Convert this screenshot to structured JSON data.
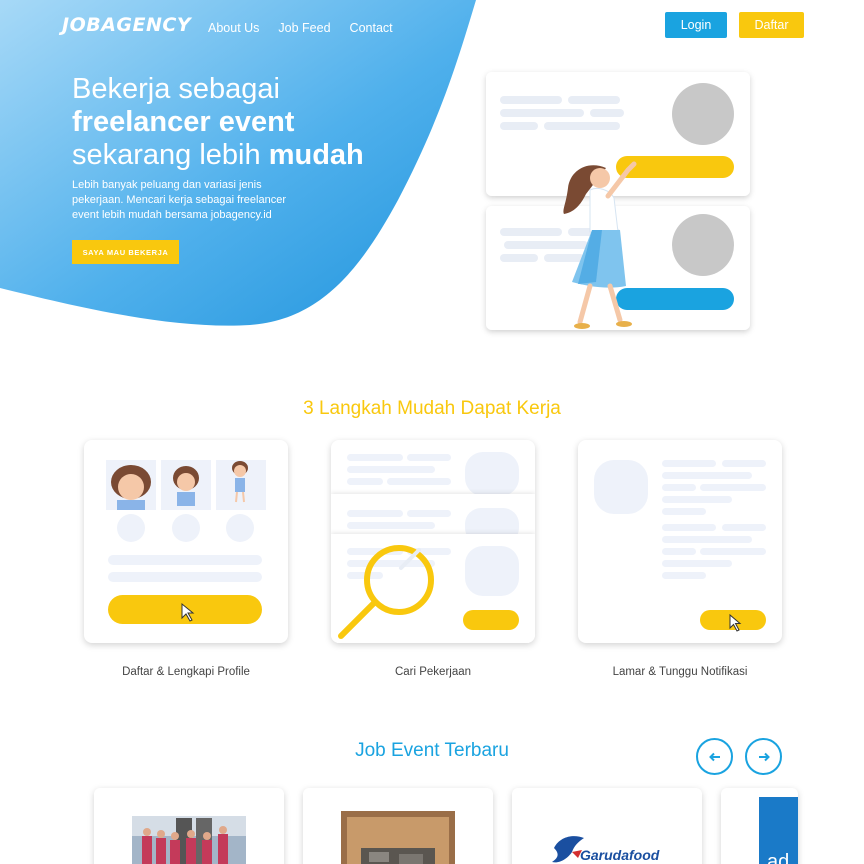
{
  "header": {
    "logo": "JOBAGENCY",
    "nav": [
      "About Us",
      "Job Feed",
      "Contact"
    ],
    "login_label": "Login",
    "daftar_label": "Daftar"
  },
  "hero": {
    "line1": "Bekerja sebagai",
    "line2": "freelancer event",
    "line3_normal": "sekarang lebih ",
    "line3_bold": "mudah",
    "description": "Lebih banyak peluang dan variasi jenis pekerjaan. Mencari kerja sebagai freelancer event lebih mudah bersama jobagency.id",
    "cta_label": "SAYA MAU BEKERJA"
  },
  "steps": {
    "title": "3 Langkah Mudah Dapat Kerja",
    "items": [
      {
        "label": "Daftar & Lengkapi Profile"
      },
      {
        "label": "Cari Pekerjaan"
      },
      {
        "label": "Lamar & Tunggu Notifikasi"
      }
    ]
  },
  "jobs": {
    "title": "Job Event Terbaru",
    "prev_icon": "arrow-left-icon",
    "next_icon": "arrow-right-icon",
    "cards": [
      {
        "image": "group-photo"
      },
      {
        "image": "food-photo"
      },
      {
        "image": "logo",
        "logo_text": "Garudafood"
      },
      {
        "image": "blue-banner",
        "banner_text": "ad"
      }
    ]
  },
  "colors": {
    "primary": "#1aa3e0",
    "accent": "#f9c80e",
    "placeholder": "#e8edf5"
  }
}
